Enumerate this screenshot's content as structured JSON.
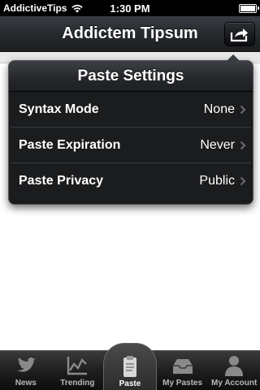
{
  "status_bar": {
    "carrier": "AddictiveTips",
    "time": "1:30 PM"
  },
  "nav": {
    "title": "Addictem Tipsum",
    "share_icon": "share-icon"
  },
  "popover": {
    "title": "Paste Settings",
    "rows": [
      {
        "label": "Syntax Mode",
        "value": "None"
      },
      {
        "label": "Paste Expiration",
        "value": "Never"
      },
      {
        "label": "Paste Privacy",
        "value": "Public"
      }
    ]
  },
  "tab_bar": {
    "tabs": [
      {
        "label": "News",
        "icon": "bird-icon",
        "active": false
      },
      {
        "label": "Trending",
        "icon": "chart-icon",
        "active": false
      },
      {
        "label": "Paste",
        "icon": "clipboard-icon",
        "active": true
      },
      {
        "label": "My Pastes",
        "icon": "inbox-icon",
        "active": false
      },
      {
        "label": "My Account",
        "icon": "person-icon",
        "active": false
      }
    ]
  },
  "colors": {
    "nav_dark": "#26292d",
    "popover_bg": "#1b1c1e",
    "tab_inactive_label": "#b8b8b8"
  }
}
